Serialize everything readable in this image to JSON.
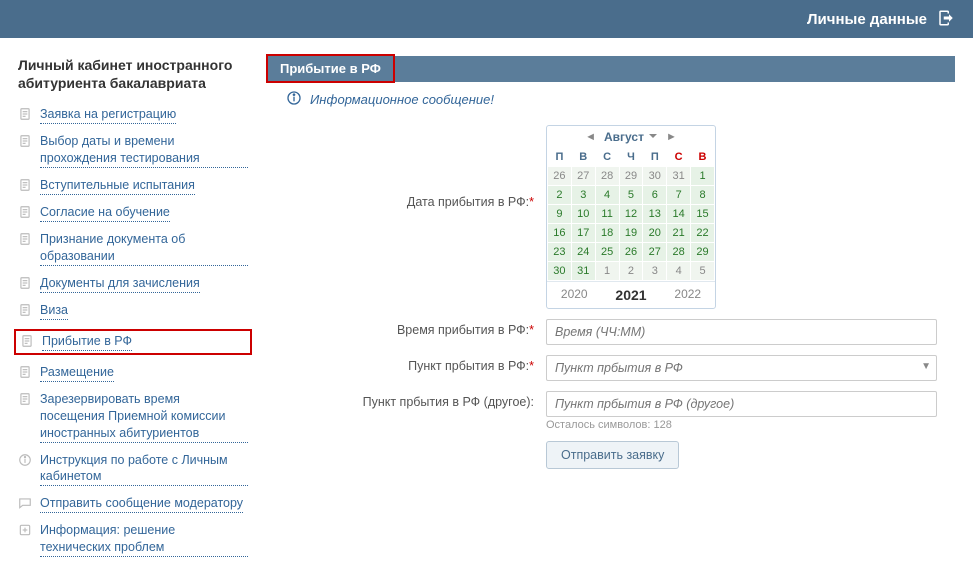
{
  "topbar": {
    "title": "Личные данные"
  },
  "sidebar": {
    "title": "Личный кабинет иностранного абитуриента бакалавриата",
    "items": [
      {
        "label": "Заявка на регистрацию",
        "icon": "doc"
      },
      {
        "label": "Выбор даты и времени прохождения тестирования",
        "icon": "doc"
      },
      {
        "label": "Вступительные испытания",
        "icon": "doc"
      },
      {
        "label": "Согласие на обучение",
        "icon": "doc"
      },
      {
        "label": "Признание документа об образовании",
        "icon": "doc"
      },
      {
        "label": "Документы для зачисления",
        "icon": "doc"
      },
      {
        "label": "Виза",
        "icon": "doc"
      },
      {
        "label": "Прибытие в РФ",
        "icon": "doc",
        "highlight": true
      },
      {
        "label": "Размещение",
        "icon": "doc"
      },
      {
        "label": "Зарезервировать время посещения Приемной комиссии иностранных абитуриентов",
        "icon": "doc"
      },
      {
        "label": "Инструкция по работе с Личным кабинетом",
        "icon": "info"
      },
      {
        "label": "Отправить сообщение модератору",
        "icon": "chat"
      },
      {
        "label": "Информация: решение технических проблем",
        "icon": "plus"
      }
    ]
  },
  "panel": {
    "title": "Прибытие в РФ",
    "info": "Информационное сообщение!",
    "fields": {
      "arrival_date_label": "Дата прибытия в РФ:",
      "arrival_time_label": "Время прибытия в РФ:",
      "arrival_time_placeholder": "Время (ЧЧ:ММ)",
      "arrival_point_label": "Пункт прбытия в РФ:",
      "arrival_point_placeholder": "Пункт прбытия в РФ",
      "arrival_point_other_label": "Пункт прбытия в РФ (другое):",
      "arrival_point_other_placeholder": "Пункт прбытия в РФ (другое)",
      "chars_left": "Осталось символов: 128"
    },
    "submit": "Отправить заявку"
  },
  "calendar": {
    "month": "Август",
    "dow": [
      "П",
      "В",
      "С",
      "Ч",
      "П",
      "С",
      "В"
    ],
    "weeks": [
      [
        "26",
        "27",
        "28",
        "29",
        "30",
        "31",
        "1"
      ],
      [
        "2",
        "3",
        "4",
        "5",
        "6",
        "7",
        "8"
      ],
      [
        "9",
        "10",
        "11",
        "12",
        "13",
        "14",
        "15"
      ],
      [
        "16",
        "17",
        "18",
        "19",
        "20",
        "21",
        "22"
      ],
      [
        "23",
        "24",
        "25",
        "26",
        "27",
        "28",
        "29"
      ],
      [
        "30",
        "31",
        "1",
        "2",
        "3",
        "4",
        "5"
      ]
    ],
    "year_prev": "2020",
    "year_cur": "2021",
    "year_next": "2022"
  }
}
